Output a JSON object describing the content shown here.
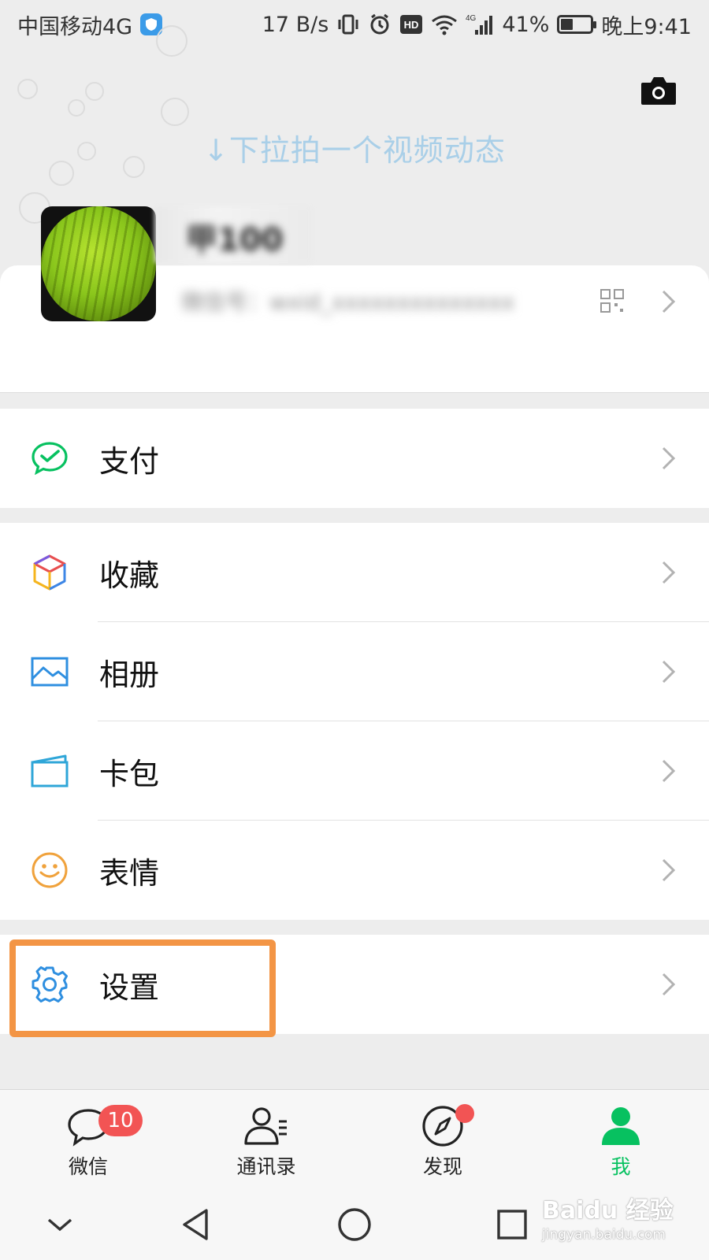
{
  "status_bar": {
    "carrier": "中国移动4G",
    "speed": "17 B/s",
    "battery_percent": "41%",
    "battery_level": 0.41,
    "time": "晚上9:41"
  },
  "header": {
    "pull_hint": "↓下拉拍一个视频动态"
  },
  "profile": {
    "nickname": "甲100",
    "wechat_id": "微信号：wxid_xxxxxxxxxxxxxx"
  },
  "menu": {
    "pay": {
      "label": "支付",
      "icon": "wechat-pay-icon"
    },
    "favorites": {
      "label": "收藏",
      "icon": "cube-icon"
    },
    "album": {
      "label": "相册",
      "icon": "image-icon"
    },
    "cards": {
      "label": "卡包",
      "icon": "card-wallet-icon"
    },
    "stickers": {
      "label": "表情",
      "icon": "smiley-icon"
    },
    "settings": {
      "label": "设置",
      "icon": "gear-icon"
    }
  },
  "tabs": [
    {
      "label": "微信",
      "badge": "10"
    },
    {
      "label": "通讯录"
    },
    {
      "label": "发现"
    },
    {
      "label": "我"
    }
  ],
  "colors": {
    "wechat_green": "#07c160",
    "highlight": "#f39545",
    "badge_red": "#f25454",
    "hint_blue": "#a9cfe8"
  },
  "watermark": {
    "brand": "Baidu 经验",
    "url": "jingyan.baidu.com"
  }
}
